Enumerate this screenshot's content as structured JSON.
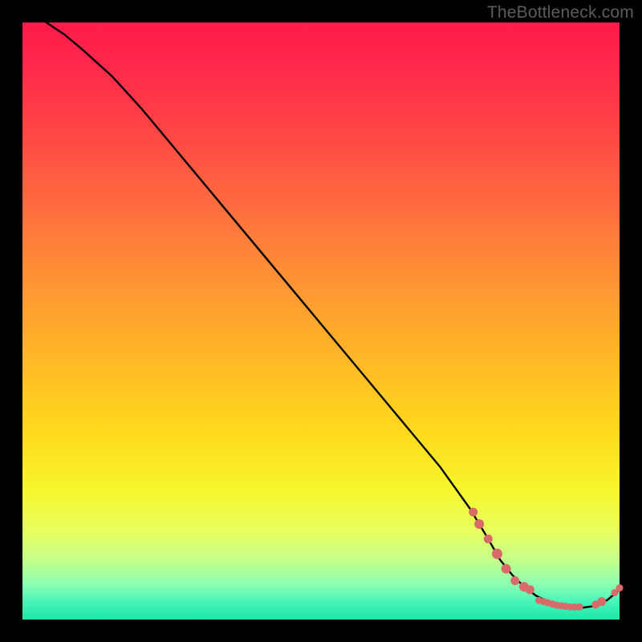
{
  "attribution": "TheBottleneck.com",
  "chart_data": {
    "type": "line",
    "title": "",
    "xlabel": "",
    "ylabel": "",
    "xlim": [
      0,
      100
    ],
    "ylim": [
      0,
      100
    ],
    "series": [
      {
        "name": "curve",
        "color": "#000000",
        "x": [
          4,
          7,
          10,
          15,
          20,
          25,
          30,
          35,
          40,
          45,
          50,
          55,
          60,
          65,
          70,
          75,
          78,
          80,
          82,
          84,
          86,
          88,
          90,
          92,
          94,
          96,
          98,
          100
        ],
        "y": [
          100,
          98,
          95.5,
          91,
          85.5,
          79.5,
          73.5,
          67.5,
          61.5,
          55.5,
          49.5,
          43.5,
          37.5,
          31.5,
          25.5,
          18.5,
          13.5,
          10,
          7.5,
          5.5,
          4,
          3,
          2.3,
          2,
          2,
          2.3,
          3.3,
          5
        ]
      }
    ],
    "markers": [
      {
        "x": 75.5,
        "y": 18.0,
        "r": 5.5
      },
      {
        "x": 76.5,
        "y": 16.0,
        "r": 6.0
      },
      {
        "x": 78.0,
        "y": 13.5,
        "r": 5.5
      },
      {
        "x": 79.5,
        "y": 11.0,
        "r": 6.5
      },
      {
        "x": 81.0,
        "y": 8.5,
        "r": 6.0
      },
      {
        "x": 82.5,
        "y": 6.5,
        "r": 5.5
      },
      {
        "x": 84.0,
        "y": 5.5,
        "r": 6.0
      },
      {
        "x": 85.0,
        "y": 5.0,
        "r": 5.5
      },
      {
        "x": 86.5,
        "y": 3.2,
        "r": 4.5
      },
      {
        "x": 87.3,
        "y": 3.0,
        "r": 4.5
      },
      {
        "x": 88.0,
        "y": 2.8,
        "r": 4.5
      },
      {
        "x": 88.8,
        "y": 2.6,
        "r": 4.5
      },
      {
        "x": 89.5,
        "y": 2.4,
        "r": 4.5
      },
      {
        "x": 90.3,
        "y": 2.3,
        "r": 4.5
      },
      {
        "x": 91.0,
        "y": 2.2,
        "r": 4.5
      },
      {
        "x": 91.8,
        "y": 2.1,
        "r": 4.5
      },
      {
        "x": 92.5,
        "y": 2.1,
        "r": 4.5
      },
      {
        "x": 93.3,
        "y": 2.1,
        "r": 4.5
      },
      {
        "x": 96.0,
        "y": 2.5,
        "r": 5.0
      },
      {
        "x": 97.0,
        "y": 3.0,
        "r": 5.5
      },
      {
        "x": 99.2,
        "y": 4.5,
        "r": 4.5
      },
      {
        "x": 100.0,
        "y": 5.3,
        "r": 4.5
      }
    ],
    "marker_color": "#d96a6a",
    "legend": false,
    "grid": false
  }
}
